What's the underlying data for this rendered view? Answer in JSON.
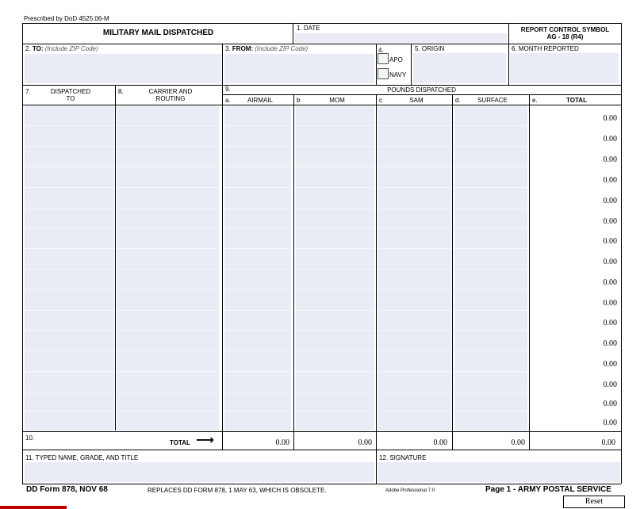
{
  "header": {
    "prescribed": "Prescribed by DoD 4525.06-M",
    "form_title": "MILITARY  MAIL DISPATCHED",
    "date_label": "1. DATE",
    "rcs_line1": "REPORT CONTROL SYMBOL",
    "rcs_line2": "AG - 18 (R4)"
  },
  "address": {
    "to_num": "2.",
    "to_label": "TO:",
    "to_hint": "(Include ZIP Code)",
    "from_num": "3.",
    "from_label": "FROM:",
    "from_hint": "(Include ZIP Code)",
    "box4_label": "4.",
    "apo_label": "APO",
    "navy_label": "NAVY",
    "origin_label": "5. ORIGIN",
    "month_label": "6. MONTH REPORTED"
  },
  "columns": {
    "c7_num": "7.",
    "c7_line1": "DISPATCHED",
    "c7_line2": "TO",
    "c8_num": "8.",
    "c8_line1": "CARRIER AND",
    "c8_line2": "ROUTING",
    "c9_num": "9.",
    "pounds": "POUNDS DISPATCHED",
    "a_letter": "a.",
    "a_label": "AIRMAIL",
    "b_letter": "b",
    "b_label": "MOM",
    "c_letter": "c",
    "c_label": "SAM",
    "d_letter": "d.",
    "d_label": "SURFACE",
    "e_letter": "e.",
    "e_label": "TOTAL"
  },
  "rows_totals": [
    "0.00",
    "0.00",
    "0.00",
    "0.00",
    "0.00",
    "0.00",
    "0.00",
    "0.00",
    "0.00",
    "0.00",
    "0.00",
    "0.00",
    "0.00",
    "0.00",
    "0.00",
    "0.00"
  ],
  "total_row": {
    "num": "10.",
    "label": "TOTAL",
    "arrow": "⟶",
    "airmail": "0.00",
    "mom": "0.00",
    "sam": "0.00",
    "surface": "0.00",
    "total": "0.00"
  },
  "signature": {
    "name_label": "11. TYPED NAME, GRADE, AND TITLE",
    "sig_label": "12. SIGNATURE"
  },
  "footer": {
    "form_id": "DD Form 878, NOV 68",
    "replaces": "REPLACES DD FORM 878, 1 MAY 63, WHICH IS OBSOLETE.",
    "adobe": "Adobe Professional 7.0",
    "page": "Page 1 - ARMY POSTAL SERVICE",
    "reset": "Reset"
  }
}
